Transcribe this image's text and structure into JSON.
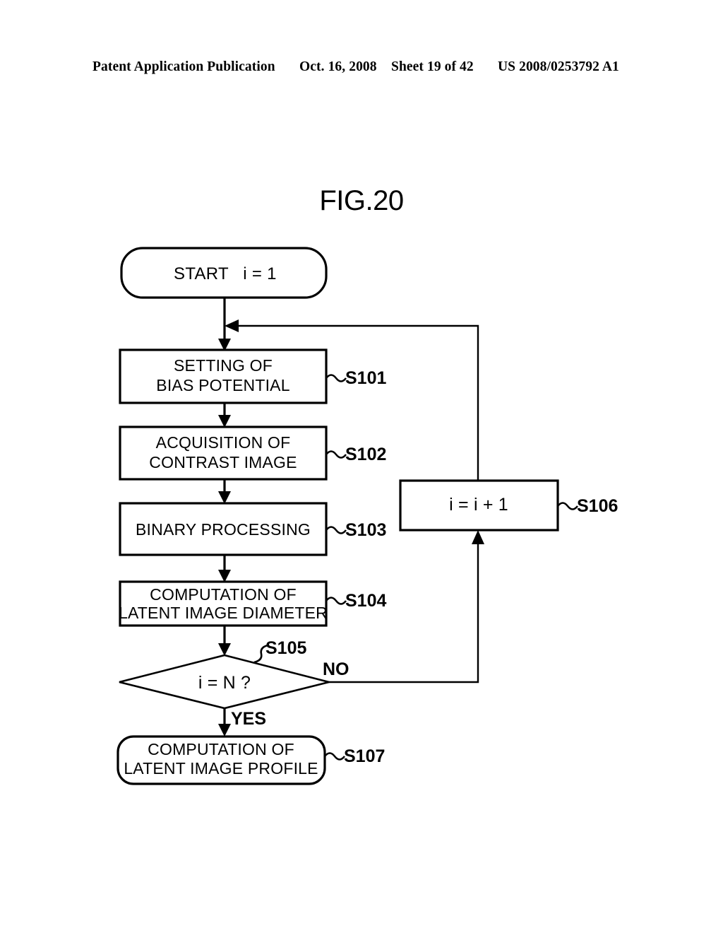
{
  "header": {
    "publication": "Patent Application Publication",
    "date": "Oct. 16, 2008",
    "sheet": "Sheet 19 of 42",
    "patent_number": "US 2008/0253792 A1"
  },
  "figure": {
    "title": "FIG.20"
  },
  "flowchart": {
    "start": {
      "label_main": "START",
      "label_var": "i = 1"
    },
    "steps": [
      {
        "id": "S101",
        "line1": "SETTING OF",
        "line2": "BIAS POTENTIAL",
        "step_label": "S101"
      },
      {
        "id": "S102",
        "line1": "ACQUISITION OF",
        "line2": "CONTRAST IMAGE",
        "step_label": "S102"
      },
      {
        "id": "S103",
        "line1": "BINARY PROCESSING",
        "line2": "",
        "step_label": "S103"
      },
      {
        "id": "S104",
        "line1": "COMPUTATION OF",
        "line2": "LATENT IMAGE DIAMETER",
        "step_label": "S104"
      }
    ],
    "decision": {
      "text": "i = N ?",
      "step_label": "S105",
      "yes_label": "YES",
      "no_label": "NO"
    },
    "increment": {
      "text": "i = i + 1",
      "step_label": "S106"
    },
    "end": {
      "line1": "COMPUTATION OF",
      "line2": "LATENT IMAGE PROFILE",
      "step_label": "S107"
    }
  },
  "colors": {
    "ink": "#000000",
    "paper": "#ffffff"
  }
}
